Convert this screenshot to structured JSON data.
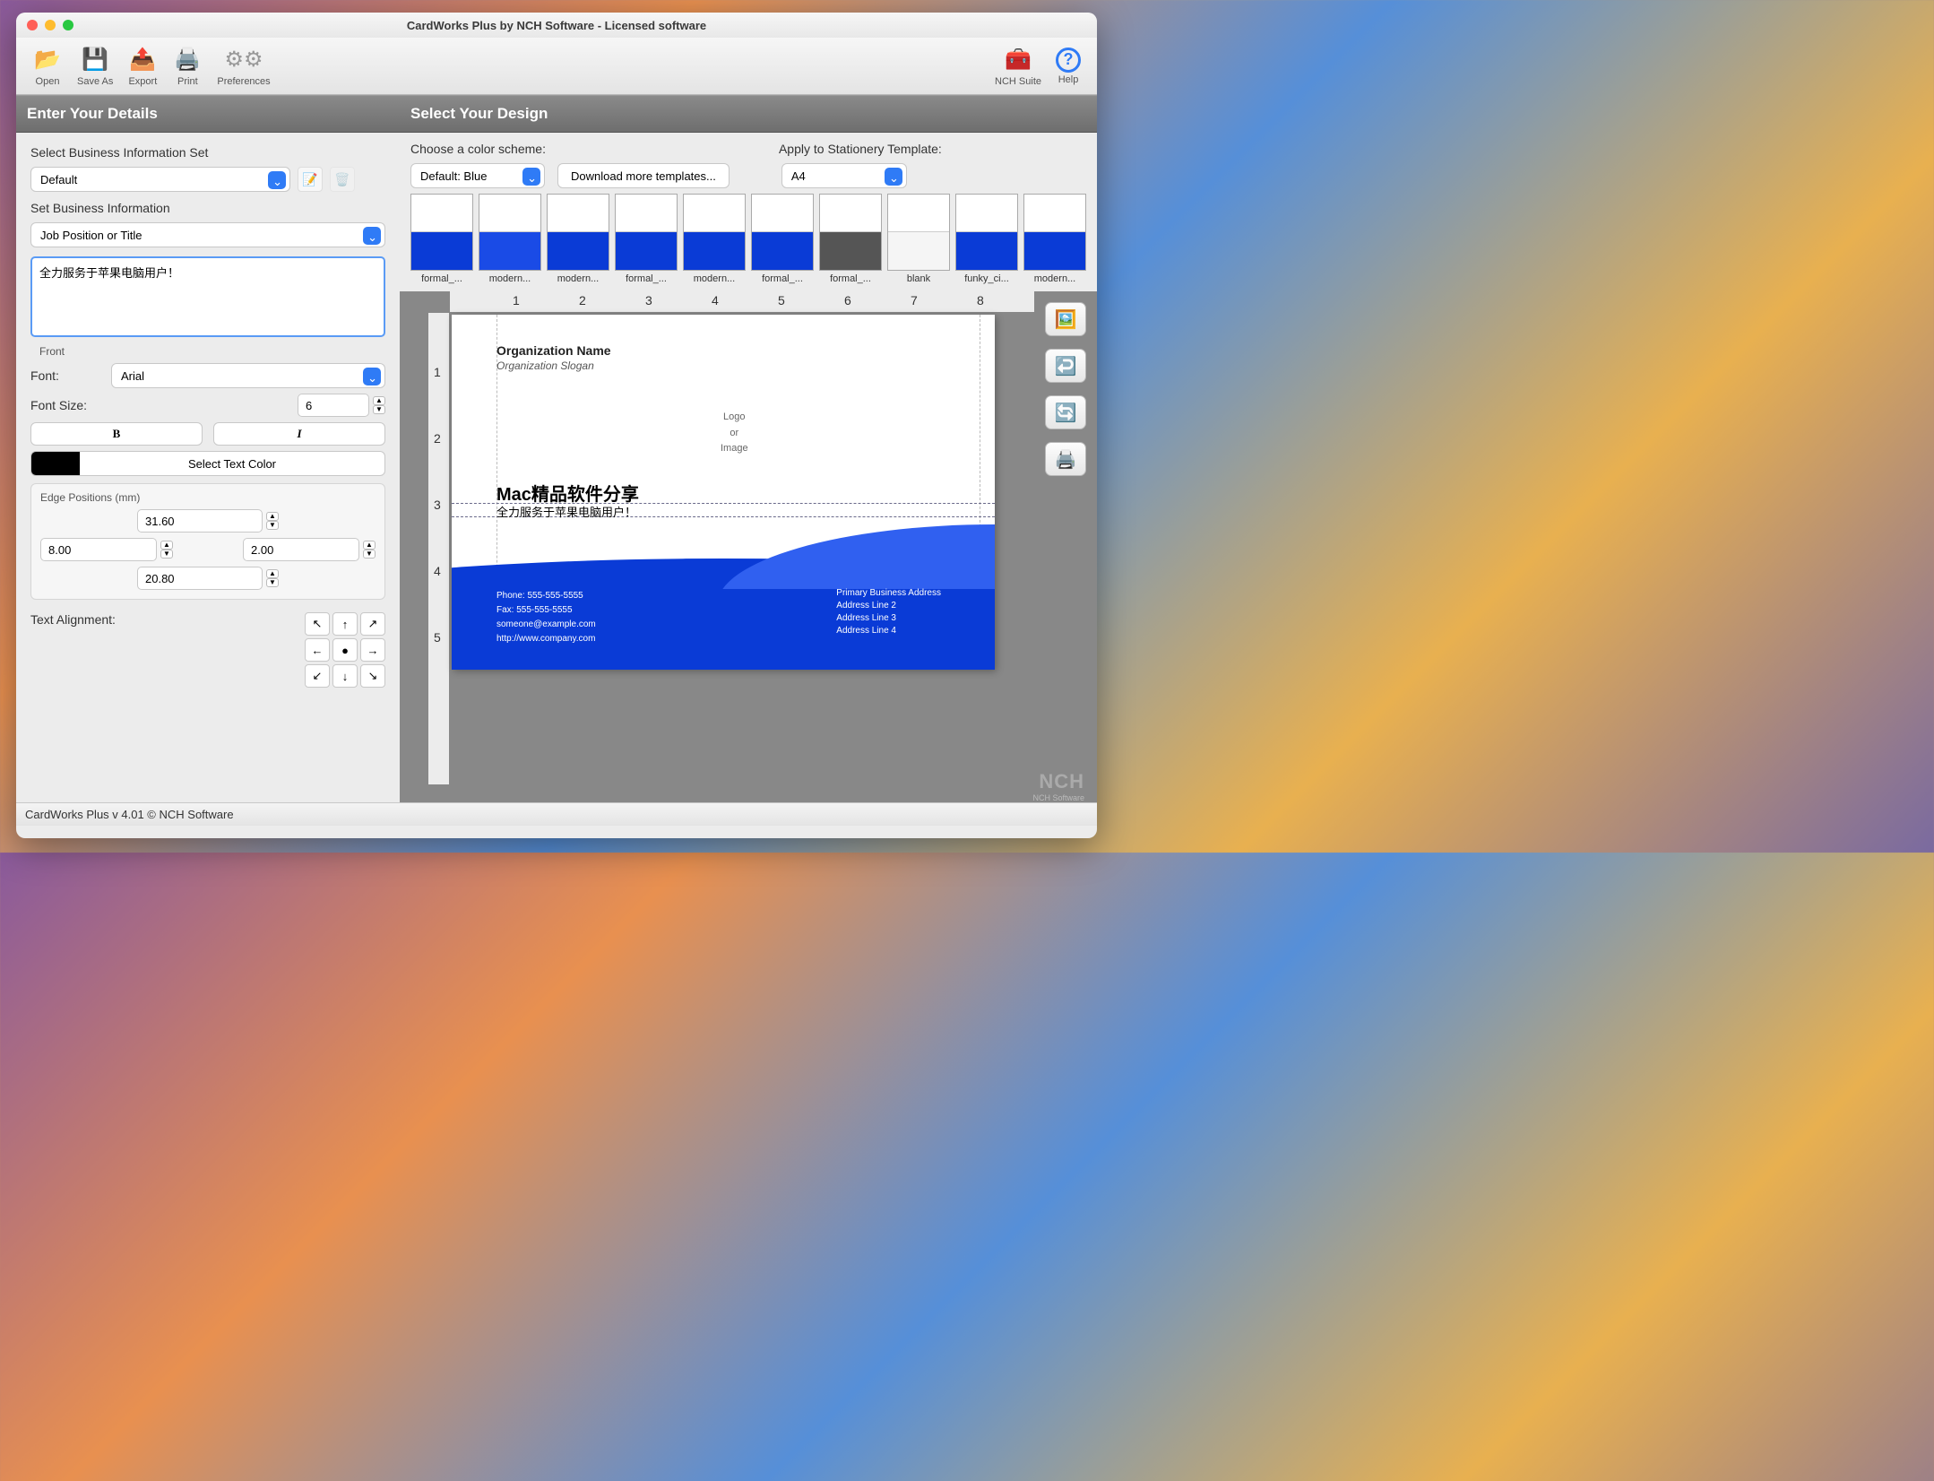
{
  "window_title": "CardWorks Plus by NCH Software - Licensed software",
  "toolbar": {
    "open": "Open",
    "saveas": "Save As",
    "export": "Export",
    "print": "Print",
    "prefs": "Preferences",
    "nchsuite": "NCH Suite",
    "help": "Help"
  },
  "panels": {
    "left_title": "Enter Your Details",
    "right_title": "Select Your Design"
  },
  "left": {
    "select_info_set": "Select Business Information Set",
    "info_set_value": "Default",
    "set_info": "Set Business Information",
    "field_select_value": "Job Position or Title",
    "text_value": "全力服务于苹果电脑用户！",
    "tab_front": "Front",
    "font_label": "Font:",
    "font_value": "Arial",
    "fontsize_label": "Font Size:",
    "fontsize_value": "6",
    "bold": "B",
    "italic": "I",
    "color_label": "Select Text Color",
    "edge_title": "Edge Positions (mm)",
    "edge_top": "31.60",
    "edge_left": "8.00",
    "edge_right": "2.00",
    "edge_bottom": "20.80",
    "text_align_label": "Text Alignment:"
  },
  "right": {
    "scheme_label": "Choose a color scheme:",
    "template_label": "Apply to Stationery Template:",
    "scheme_value": "Default: Blue",
    "download_more": "Download more templates...",
    "template_value": "A4",
    "thumbs": [
      "formal_...",
      "modern...",
      "modern...",
      "formal_...",
      "modern...",
      "formal_...",
      "formal_...",
      "blank",
      "funky_ci...",
      "modern..."
    ]
  },
  "card": {
    "org_name": "Organization Name",
    "org_slogan": "Organization Slogan",
    "logo_line1": "Logo",
    "logo_line2": "or",
    "logo_line3": "Image",
    "mac_title": "Mac精品软件分享",
    "slogan_cn": "全力服务于苹果电脑用户！",
    "phone": "Phone: 555-555-5555",
    "fax": "Fax: 555-555-5555",
    "email": "someone@example.com",
    "url": "http://www.company.com",
    "addr1": "Primary Business Address",
    "addr2": "Address Line 2",
    "addr3": "Address Line 3",
    "addr4": "Address Line 4"
  },
  "ruler": {
    "h": [
      "1",
      "2",
      "3",
      "4",
      "5",
      "6",
      "7",
      "8"
    ],
    "v": [
      "1",
      "2",
      "3",
      "4",
      "5"
    ]
  },
  "brand": {
    "logo": "NCH",
    "sub": "NCH Software"
  },
  "statusbar": "CardWorks Plus v 4.01 © NCH Software"
}
